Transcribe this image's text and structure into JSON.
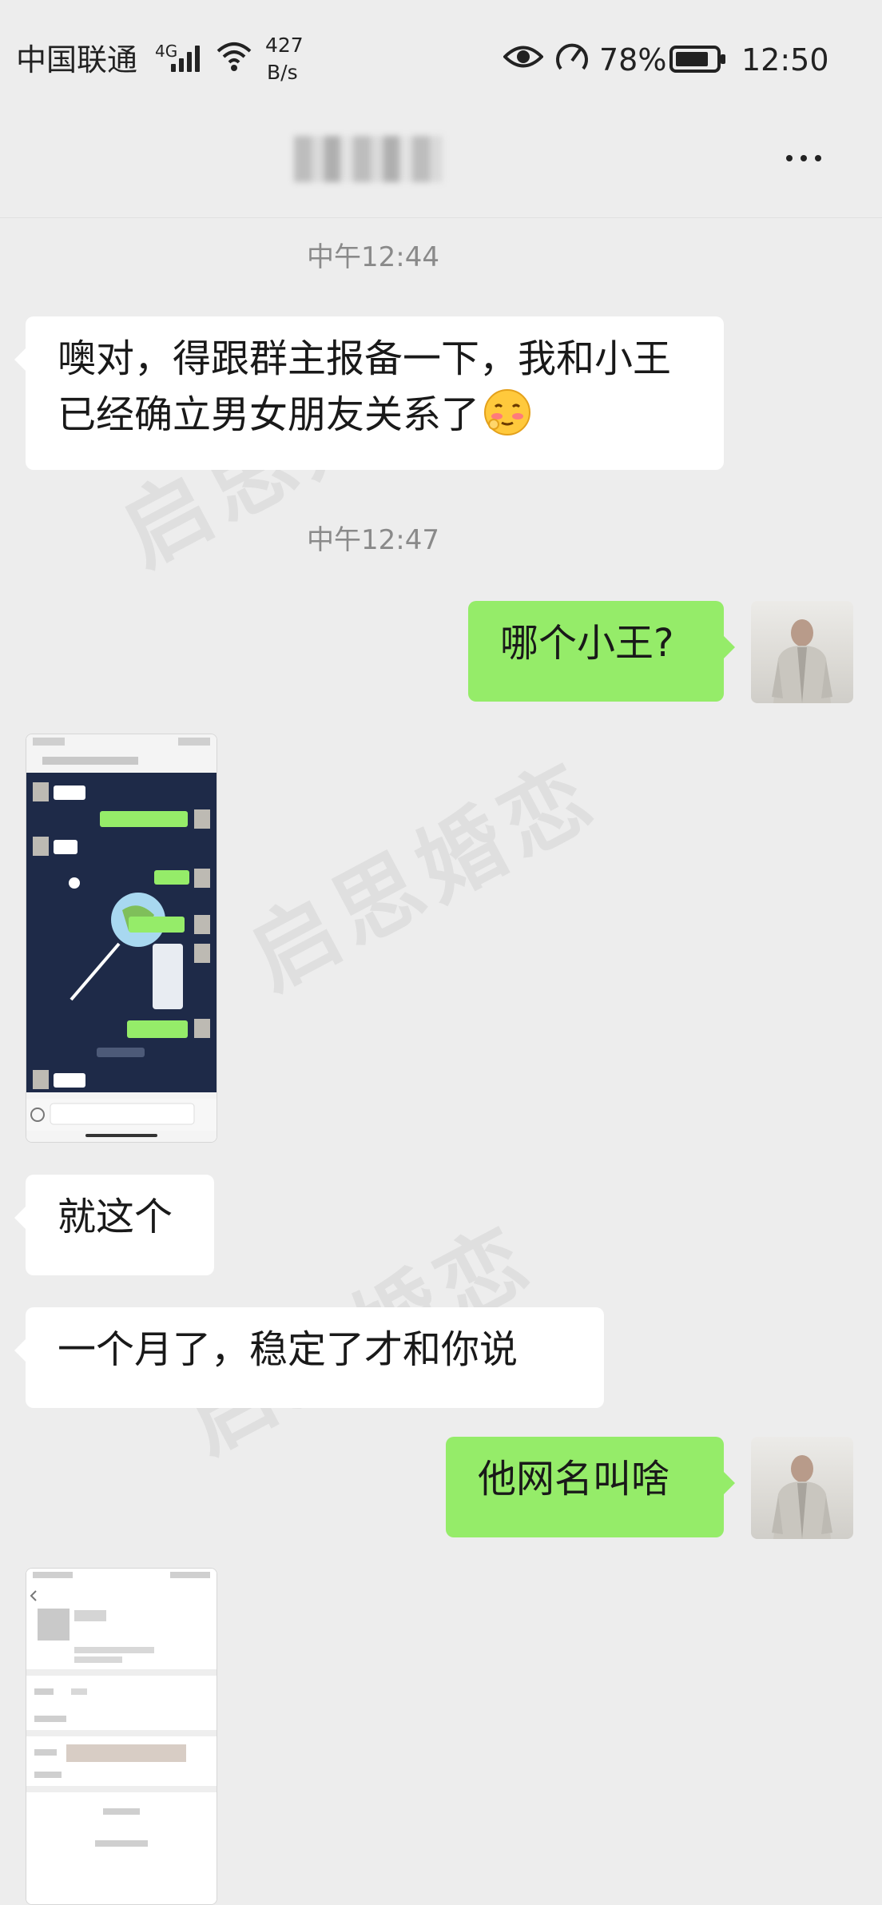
{
  "status_bar": {
    "carrier": "中国联通",
    "network_type": "4G",
    "speed_value": "427",
    "speed_unit": "B/s",
    "battery_percent": "78%",
    "time": "12:50"
  },
  "watermark_text": "启思婚恋",
  "messages": {
    "time_1": "中午12:44",
    "msg_1_text": "噢对，得跟群主报备一下，我和小王已经确立男女朋友关系了",
    "time_2": "中午12:47",
    "msg_2_text": "哪个小王?",
    "msg_4_text": "就这个",
    "msg_5_text": "一个月了，稳定了才和你说",
    "msg_6_text": "他网名叫啥"
  },
  "colors": {
    "background": "#ededed",
    "sent_bubble": "#95ec69",
    "received_bubble": "#ffffff",
    "timestamp": "#8a8a8a"
  }
}
